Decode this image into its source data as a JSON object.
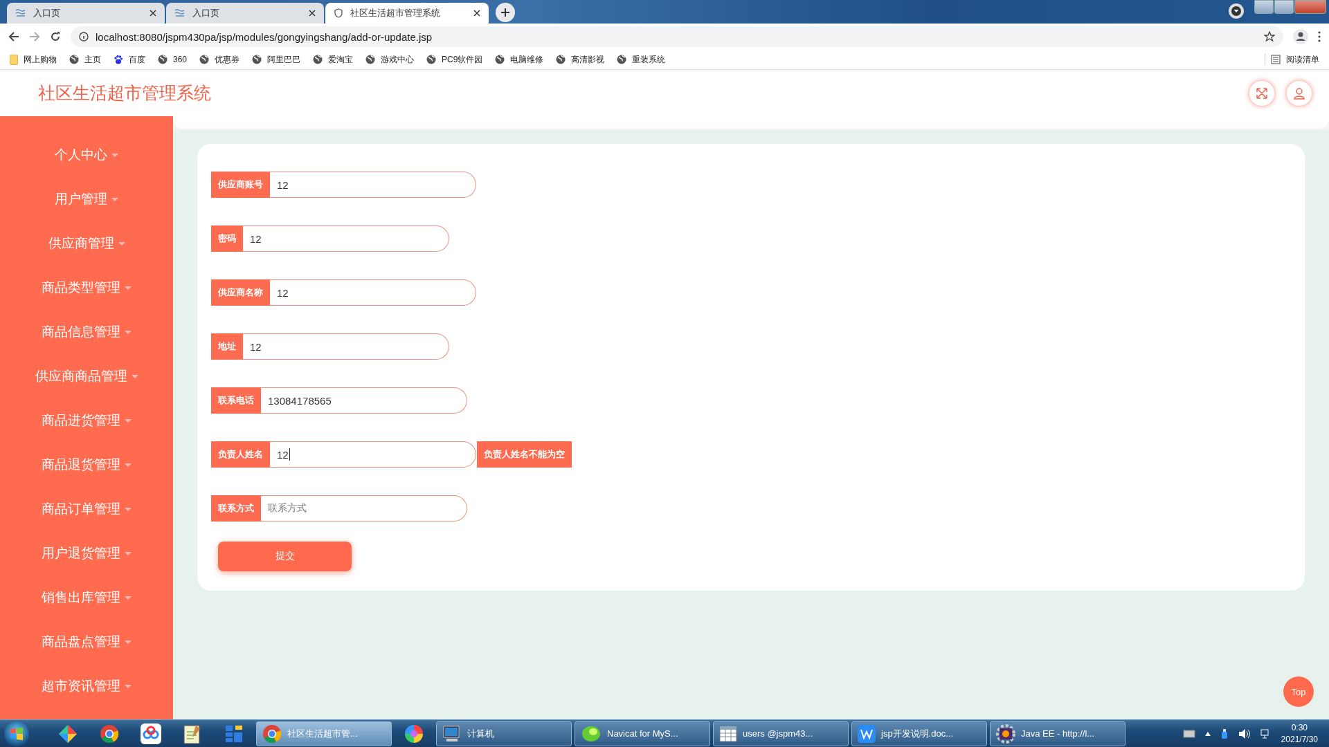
{
  "browser": {
    "tabs": [
      {
        "title": "入口页",
        "selected": false
      },
      {
        "title": "入口页",
        "selected": false
      },
      {
        "title": "社区生活超市管理系统",
        "selected": true
      }
    ],
    "url": "localhost:8080/jspm430pa/jsp/modules/gongyingshang/add-or-update.jsp",
    "bookmarks": [
      {
        "kind": "folder",
        "label": "网上购物"
      },
      {
        "kind": "globe",
        "label": "主页"
      },
      {
        "kind": "paw",
        "label": "百度"
      },
      {
        "kind": "globe",
        "label": "360"
      },
      {
        "kind": "globe",
        "label": "优惠券"
      },
      {
        "kind": "globe",
        "label": "阿里巴巴"
      },
      {
        "kind": "globe",
        "label": "爱淘宝"
      },
      {
        "kind": "globe",
        "label": "游戏中心"
      },
      {
        "kind": "globe",
        "label": "PC9软件园"
      },
      {
        "kind": "globe",
        "label": "电脑维修"
      },
      {
        "kind": "globe",
        "label": "高清影视"
      },
      {
        "kind": "globe",
        "label": "重装系统"
      }
    ],
    "reading_list": "阅读清单"
  },
  "app": {
    "title": "社区生活超市管理系统",
    "sidebar": [
      {
        "label": "个人中心"
      },
      {
        "label": "用户管理"
      },
      {
        "label": "供应商管理"
      },
      {
        "label": "商品类型管理"
      },
      {
        "label": "商品信息管理"
      },
      {
        "label": "供应商商品管理"
      },
      {
        "label": "商品进货管理"
      },
      {
        "label": "商品退货管理"
      },
      {
        "label": "商品订单管理"
      },
      {
        "label": "用户退货管理"
      },
      {
        "label": "销售出库管理"
      },
      {
        "label": "商品盘点管理"
      },
      {
        "label": "超市资讯管理"
      }
    ],
    "form": {
      "fields": [
        {
          "label": "供应商账号",
          "value": "12",
          "focused": false
        },
        {
          "label": "密码",
          "value": "12",
          "focused": false
        },
        {
          "label": "供应商名称",
          "value": "12",
          "focused": false
        },
        {
          "label": "地址",
          "value": "12",
          "focused": false
        },
        {
          "label": "联系电话",
          "value": "13084178565",
          "focused": false
        },
        {
          "label": "负责人姓名",
          "value": "12",
          "focused": true,
          "error": "负责人姓名不能为空"
        },
        {
          "label": "联系方式",
          "placeholder": "联系方式",
          "focused": false
        }
      ],
      "submit": "提交"
    },
    "top_button": "Top"
  },
  "taskbar": {
    "items": [
      {
        "kind": "diamond"
      },
      {
        "kind": "chrome"
      },
      {
        "kind": "cloud"
      },
      {
        "kind": "notepad"
      },
      {
        "kind": "grid"
      },
      {
        "kind": "chrome",
        "label": "社区生活超市管...",
        "selected": true
      },
      {
        "kind": "pinwheel"
      },
      {
        "kind": "computer",
        "label": "计算机",
        "selected": false
      },
      {
        "kind": "navicat",
        "label": "Navicat for MyS...",
        "selected": false
      },
      {
        "kind": "table",
        "label": "users @jspm43...",
        "selected": false
      },
      {
        "kind": "wps",
        "label": "jsp开发说明.doc...",
        "selected": false
      },
      {
        "kind": "javaee",
        "label": "Java EE - http://l...",
        "selected": false
      }
    ],
    "clock": {
      "time": "0:30",
      "date": "2021/7/30"
    }
  }
}
